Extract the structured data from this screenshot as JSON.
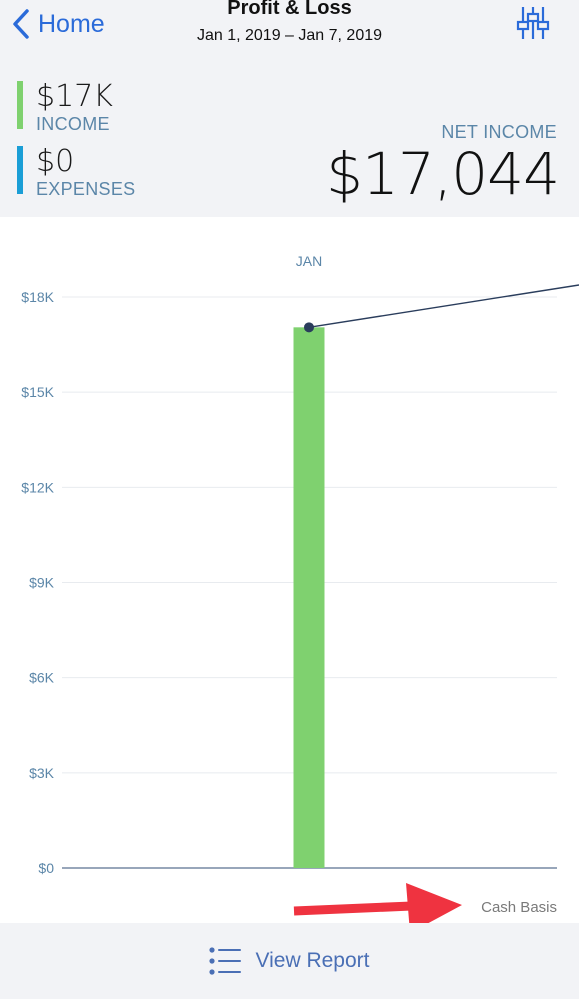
{
  "nav": {
    "back_label": "Home",
    "title": "Profit & Loss",
    "subtitle": "Jan 1, 2019 – Jan 7, 2019"
  },
  "summary": {
    "income_amount": "$17K",
    "income_label": "INCOME",
    "income_color": "#7fd16f",
    "expenses_amount": "$0",
    "expenses_label": "EXPENSES",
    "expenses_color": "#1b9ed6",
    "net_label": "NET INCOME",
    "net_value": "$17,044"
  },
  "chart_data": {
    "type": "bar",
    "categories": [
      "JAN"
    ],
    "series": [
      {
        "values": [
          17044
        ],
        "color": "#7fd16f"
      }
    ],
    "line": {
      "values": [
        17044
      ]
    },
    "yticks": [
      "$18K",
      "$15K",
      "$12K",
      "$9K",
      "$6K",
      "$3K",
      "$0"
    ],
    "ytick_values": [
      18000,
      15000,
      12000,
      9000,
      6000,
      3000,
      0
    ],
    "ylim": [
      0,
      18000
    ],
    "grid": true
  },
  "basis_label": "Cash Basis",
  "arrow_color": "#ef3340",
  "footer": {
    "label": "View Report",
    "icon": "list-icon"
  }
}
